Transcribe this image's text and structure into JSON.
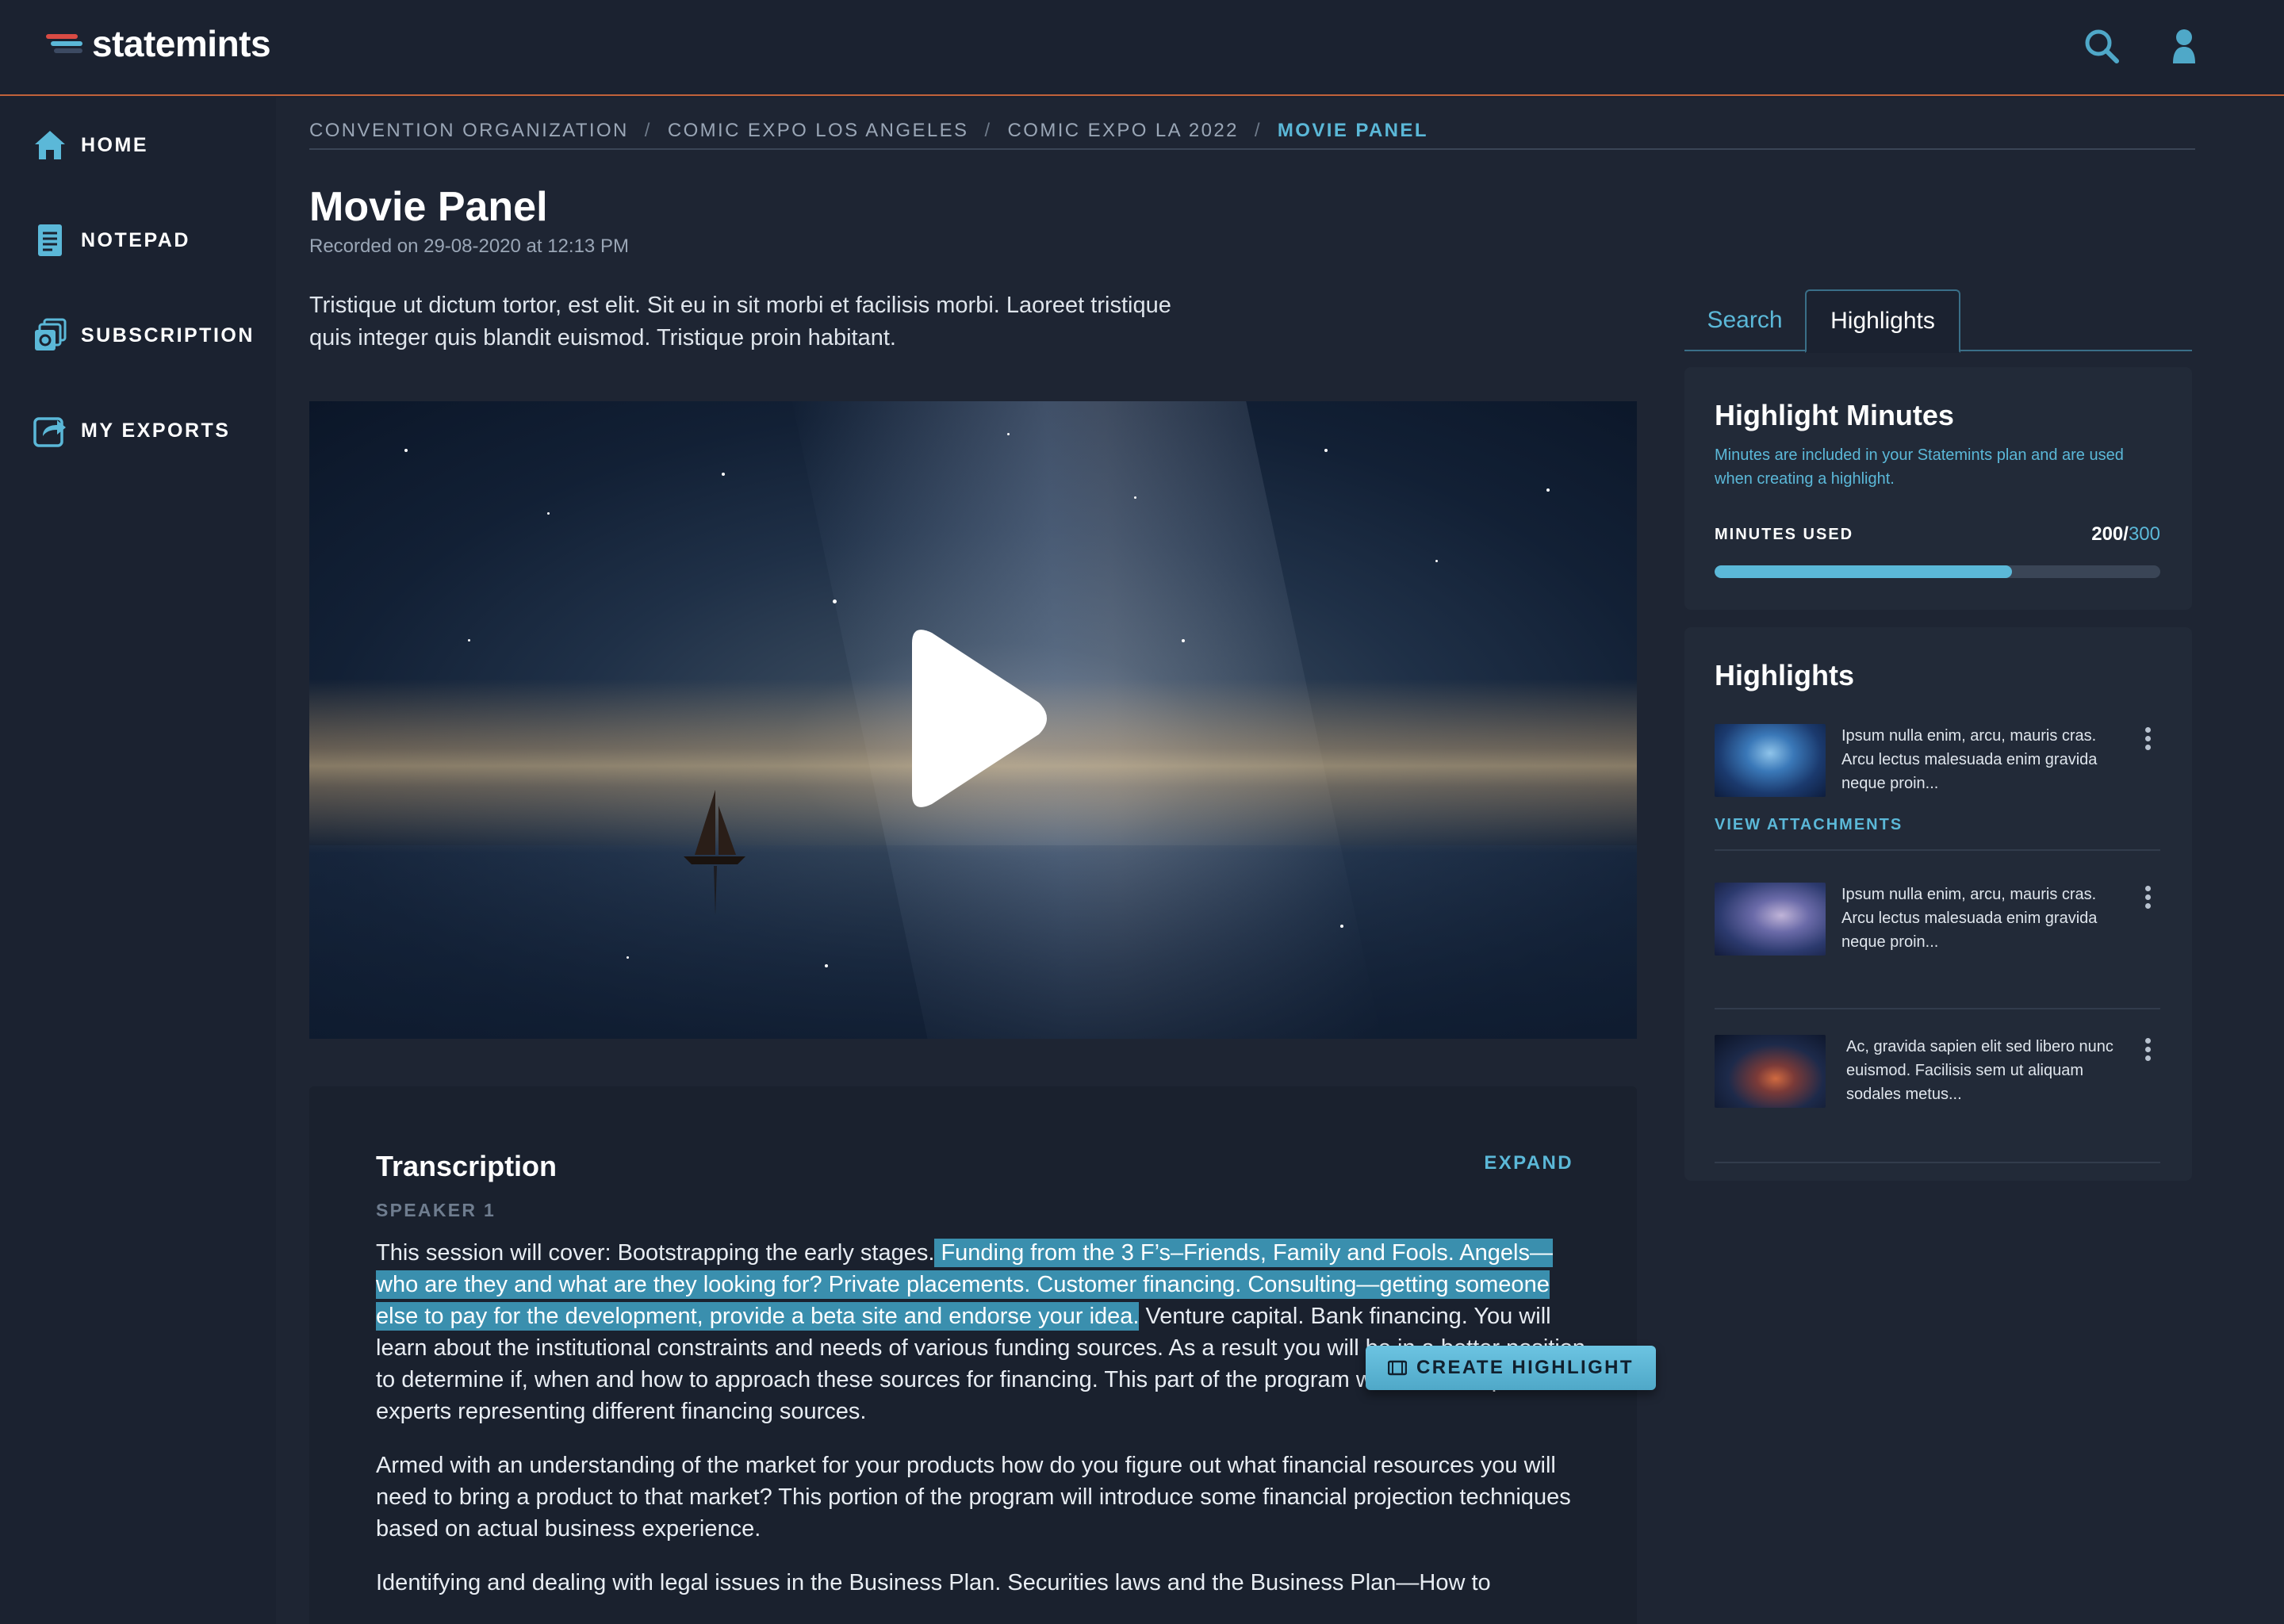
{
  "app": {
    "logo_text": "statemints"
  },
  "header": {
    "search_icon": "search-icon",
    "user_icon": "user-icon"
  },
  "sidebar": {
    "items": [
      {
        "label": "HOME",
        "icon": "home-icon"
      },
      {
        "label": "NOTEPAD",
        "icon": "notepad-icon"
      },
      {
        "label": "SUBSCRIPTION",
        "icon": "subscription-icon"
      },
      {
        "label": "MY EXPORTS",
        "icon": "export-icon"
      }
    ]
  },
  "breadcrumb": {
    "items": [
      "CONVENTION ORGANIZATION",
      "COMIC EXPO LOS ANGELES",
      "COMIC EXPO LA 2022",
      "MOVIE PANEL"
    ],
    "separator": "/"
  },
  "page": {
    "title": "Movie Panel",
    "subtitle": "Recorded on 29-08-2020 at 12:13 PM",
    "description": "Tristique ut dictum tortor, est elit. Sit eu in sit morbi et facilisis morbi. Laoreet tristique quis integer quis blandit euismod. Tristique proin habitant."
  },
  "video": {
    "play_icon": "play-icon"
  },
  "transcription": {
    "title": "Transcription",
    "expand_label": "EXPAND",
    "speaker": "SPEAKER 1",
    "p1_before": "This session will cover: Bootstrapping the early stages.",
    "p1_highlight": " Funding from the 3 F’s–Friends, Family and Fools. Angels—who are they and what are they looking for? Private placements. Customer financing. Consulting—getting someone else to pay for the development, provide a beta site and endorse your idea.",
    "p1_after": " Venture capital. Bank financing. You will learn about the institutional constraints and needs of various funding sources. As a result you will be in a better position to determine if, when and how to approach these sources for financing. This part of the program will feature a panel of experts representing different financing sources.",
    "p2": "Armed with an understanding of the market for your products how do you figure out what financial resources you will need to bring a product to that market? This portion of the program will introduce some financial projection techniques based on actual business experience.",
    "p3": "Identifying and dealing with legal issues in the Business Plan. Securities laws and the Business Plan—How to"
  },
  "create_highlight": {
    "label": "CREATE HIGHLIGHT",
    "icon": "film-icon"
  },
  "right_panel": {
    "tabs": [
      {
        "label": "Search"
      },
      {
        "label": "Highlights"
      }
    ],
    "active_tab": "Highlights",
    "minutes": {
      "title": "Highlight Minutes",
      "description": "Minutes are included in your Statemints plan and are used when creating a highlight.",
      "label": "MINUTES USED",
      "used": "200",
      "separator": "/",
      "total": "300",
      "fraction_used": 0.6667
    },
    "highlights": {
      "title": "Highlights",
      "items": [
        {
          "text": "Ipsum nulla enim, arcu, mauris cras. Arcu lectus malesuada enim gravida neque proin...",
          "link": "VIEW ATTACHMENTS"
        },
        {
          "text": "Ipsum nulla enim, arcu, mauris cras. Arcu lectus malesuada enim gravida neque proin..."
        },
        {
          "text": "Ac, gravida sapien elit sed libero nunc euismod. Facilisis sem ut aliquam sodales metus..."
        }
      ]
    }
  },
  "colors": {
    "accent": "#5bb8d8",
    "background": "#1b2230",
    "header_rule": "#c1623a",
    "highlight": "#3a8fae"
  }
}
